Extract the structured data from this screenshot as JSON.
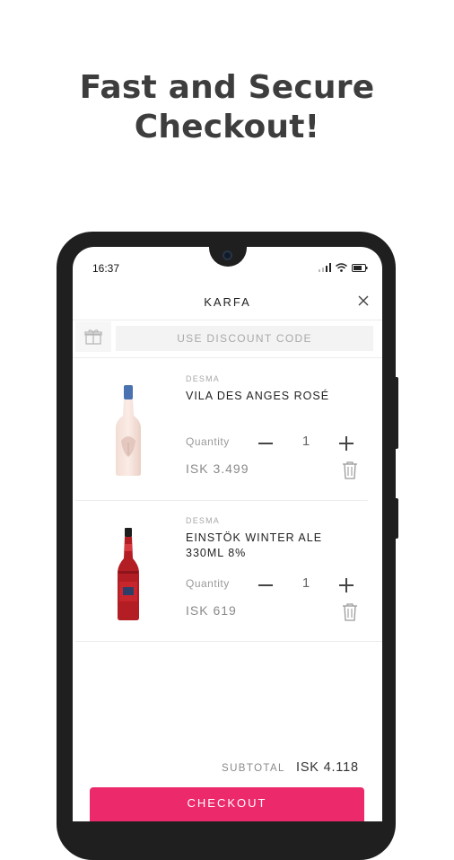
{
  "promo": {
    "headline_line1": "Fast and Secure",
    "headline_line2": "Checkout!"
  },
  "status_bar": {
    "time": "16:37",
    "icons": [
      "signal-icon",
      "wifi-icon",
      "battery-icon"
    ]
  },
  "cart": {
    "title": "KARFA",
    "close_icon": "close-icon",
    "discount_placeholder": "USE DISCOUNT CODE",
    "gift_icon": "gift-icon",
    "items": [
      {
        "brand": "DESMA",
        "name": "VILA DES ANGES ROSÉ",
        "quantity_label": "Quantity",
        "quantity": "1",
        "price": "ISK 3.499"
      },
      {
        "brand": "DESMA",
        "name": "EINSTÖK WINTER ALE 330ML 8%",
        "quantity_label": "Quantity",
        "quantity": "1",
        "price": "ISK 619"
      }
    ],
    "subtotal_label": "SUBTOTAL",
    "subtotal_value": "ISK 4.118",
    "checkout_label": "CHECKOUT"
  },
  "colors": {
    "accent": "#ec2a6b",
    "headline": "#3d3d3d",
    "phone_frame": "#1f1f1f"
  }
}
